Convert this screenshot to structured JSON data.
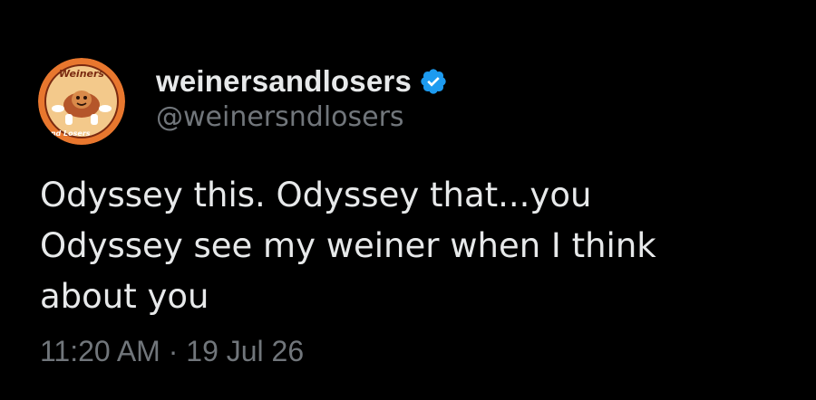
{
  "author": {
    "display_name": "weinersandlosers",
    "handle": "@weinersndlosers",
    "avatar": {
      "top_text": "Weiners",
      "bottom_text": "and Losers"
    },
    "verified": true
  },
  "tweet": {
    "line1": "Odyssey this. Odyssey that...you",
    "line2": "Odyssey see my weiner when I think",
    "line3": "about you",
    "time": "11:20 AM",
    "separator": "·",
    "date": "19 Jul 26"
  },
  "colors": {
    "background": "#000000",
    "primary_text": "#e7e9ea",
    "secondary_text": "#71767b",
    "verified_badge": "#1d9bf0",
    "avatar_bg": "#e8772e"
  },
  "icons": {
    "verified": "verified-badge-icon",
    "avatar": "profile-avatar"
  }
}
